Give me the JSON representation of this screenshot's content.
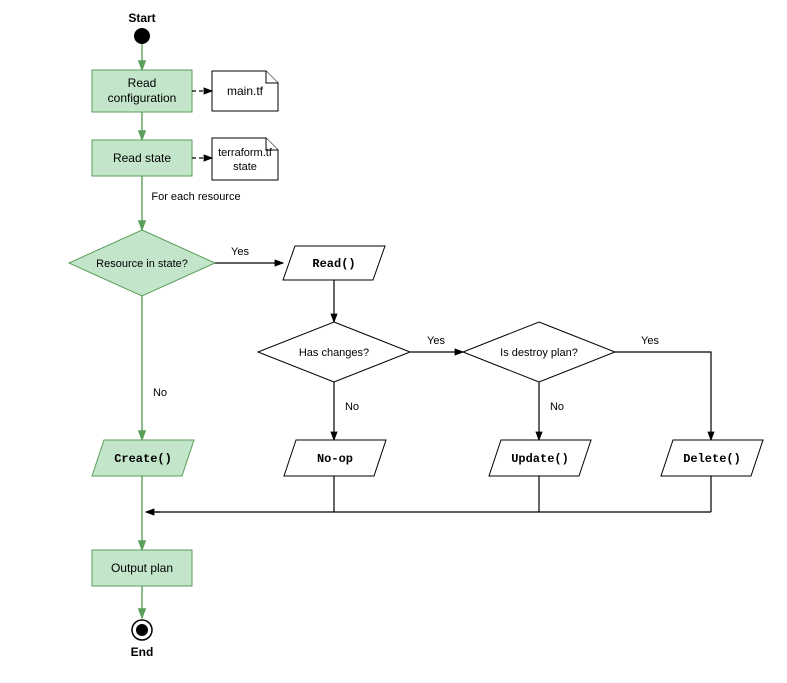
{
  "start": "Start",
  "end": "End",
  "readConfig": "Read configuration",
  "readState": "Read state",
  "mainTf": "main.tf",
  "tfState1": "terraform.tf",
  "tfState2": "state",
  "forEach": "For each resource",
  "resourceInState": "Resource in state?",
  "yes": "Yes",
  "no": "No",
  "read": "Read()",
  "hasChanges": "Has changes?",
  "isDestroy": "Is destroy plan?",
  "create": "Create()",
  "noop": "No-op",
  "update": "Update()",
  "delete": "Delete()",
  "outputPlan": "Output plan"
}
